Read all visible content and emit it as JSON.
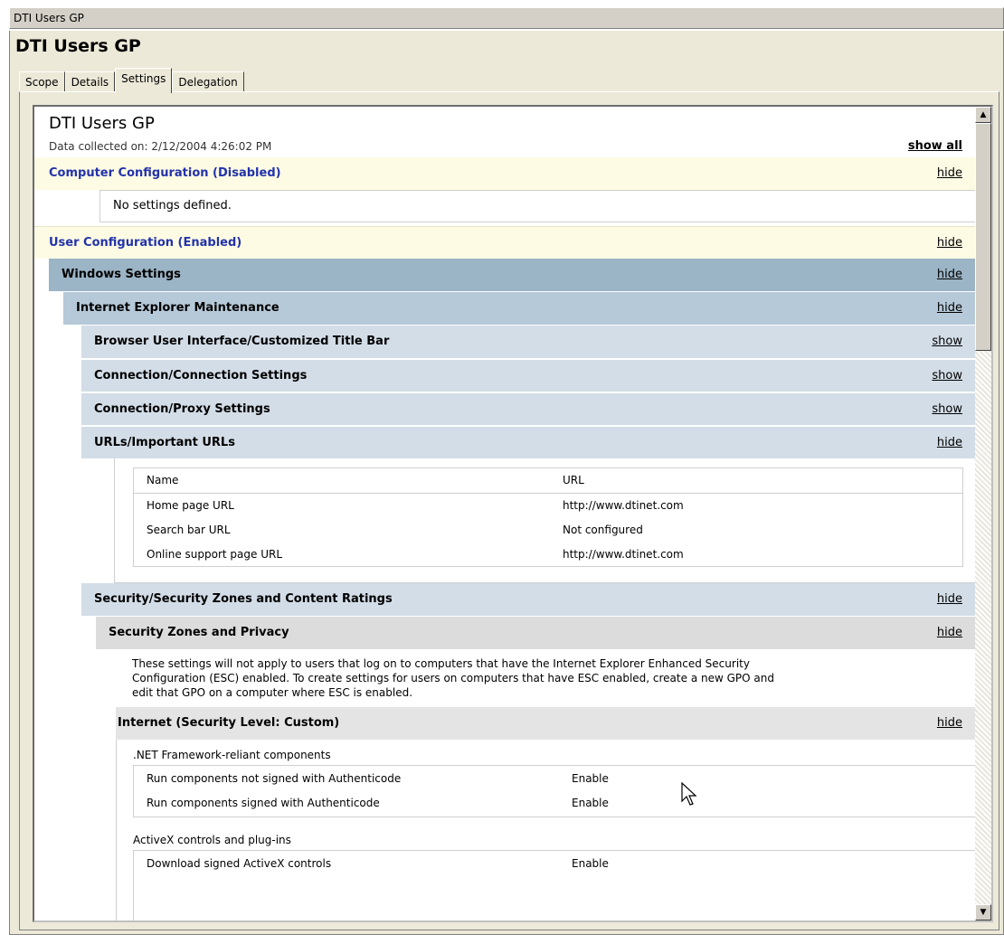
{
  "window": {
    "title": "DTI Users GP"
  },
  "panel": {
    "title": "DTI Users GP"
  },
  "tabs": [
    {
      "label": "Scope"
    },
    {
      "label": "Details"
    },
    {
      "label": "Settings"
    },
    {
      "label": "Delegation"
    }
  ],
  "report": {
    "title": "DTI Users GP",
    "collected": "Data collected on: 2/12/2004 4:26:02 PM",
    "show_all": "show all",
    "computer_config": {
      "label": "Computer Configuration (Disabled)",
      "action": "hide",
      "empty": "No settings defined."
    },
    "user_config": {
      "label": "User Configuration (Enabled)",
      "action": "hide"
    },
    "windows_settings": {
      "label": "Windows Settings",
      "action": "hide"
    },
    "iem": {
      "label": "Internet Explorer Maintenance",
      "action": "hide"
    },
    "browser_ui": {
      "label": "Browser User Interface/Customized Title Bar",
      "action": "show"
    },
    "conn_settings": {
      "label": "Connection/Connection Settings",
      "action": "show"
    },
    "proxy_settings": {
      "label": "Connection/Proxy Settings",
      "action": "show"
    },
    "important_urls": {
      "label": "URLs/Important URLs",
      "action": "hide",
      "headers": [
        "Name",
        "URL"
      ],
      "rows": [
        [
          "Home page URL",
          "http://www.dtinet.com"
        ],
        [
          "Search bar URL",
          "Not configured"
        ],
        [
          "Online support page URL",
          "http://www.dtinet.com"
        ]
      ]
    },
    "security_zones": {
      "label": "Security/Security Zones and Content Ratings",
      "action": "hide"
    },
    "zones_privacy": {
      "label": "Security Zones and Privacy",
      "action": "hide",
      "note_line1": "These settings will not apply to users that log on to computers that have the Internet Explorer Enhanced Security",
      "note_line2": "Configuration (ESC) enabled. To create settings for users on computers that have ESC enabled, create a new GPO and",
      "note_line3": "edit that GPO on a computer where ESC is enabled."
    },
    "internet_zone": {
      "label": "Internet (Security Level: Custom)",
      "action": "hide",
      "group1": ".NET Framework-reliant components",
      "group1_rows": [
        [
          "Run components not signed with Authenticode",
          "Enable"
        ],
        [
          "Run components signed with Authenticode",
          "Enable"
        ]
      ],
      "group2": "ActiveX controls and plug-ins",
      "group2_rows": [
        [
          "Download signed ActiveX controls",
          "Enable"
        ]
      ]
    }
  }
}
